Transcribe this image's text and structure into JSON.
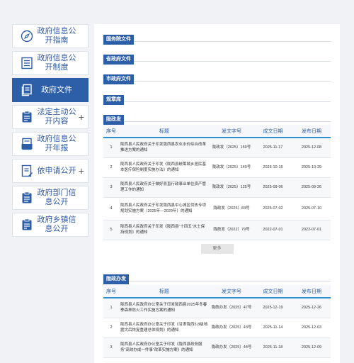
{
  "sidebar": {
    "items": [
      {
        "label": "政府信息公开指南",
        "icon": "compass-icon",
        "expandable": false,
        "active": false
      },
      {
        "label": "政府信息公开制度",
        "icon": "list-document-icon",
        "expandable": false,
        "active": false
      },
      {
        "label": "政府文件",
        "icon": "file-stack-icon",
        "expandable": false,
        "active": true
      },
      {
        "label": "法定主动公开内容",
        "icon": "clipboard-icon",
        "expandable": true,
        "active": false
      },
      {
        "label": "政府信息公开年报",
        "icon": "report-icon",
        "expandable": false,
        "active": false
      },
      {
        "label": "依申请公开",
        "icon": "application-form-icon",
        "expandable": true,
        "active": false
      },
      {
        "label": "政府部门信息公开",
        "icon": "department-doc-icon",
        "expandable": false,
        "active": false
      },
      {
        "label": "政府乡镇信息公开",
        "icon": "township-doc-icon",
        "expandable": false,
        "active": false
      }
    ],
    "expand_symbol": "+"
  },
  "categories": [
    {
      "label": "国务院文件"
    },
    {
      "label": "省政府文件"
    },
    {
      "label": "市政府文件"
    },
    {
      "label": "规章库"
    }
  ],
  "section1": {
    "tag": "陇政发",
    "headers": [
      "序号",
      "标题",
      "发文字号",
      "成文日期",
      "发布日期"
    ],
    "rows": [
      {
        "no": "1",
        "title": "陇西县人民政府关于印发陇西县农业水价综合改革推进方案的通知",
        "doc": "陇政发（2025）159号",
        "written": "2025-11-17",
        "published": "2025-12-08"
      },
      {
        "no": "2",
        "title": "陇西县人民政府关于印发《陇西县统筹城乡居民基本医疗保险制度实施办法》的通知",
        "doc": "陇政发（2025）140号",
        "written": "2025-10-15",
        "published": "2025-10-29"
      },
      {
        "no": "3",
        "title": "陇西县人民政府关于做好县直行政事业单位资产管理工作的通知",
        "doc": "陇政发（2025）125号",
        "written": "2025-09-06",
        "published": "2025-09-26"
      },
      {
        "no": "4",
        "title": "陇西县人民政府关于印发陇西县中心城区供热专项规划实施方案（2025年—2029年）的通知",
        "doc": "陇政发（2025）83号",
        "written": "2025-07-02",
        "published": "2025-07-10"
      },
      {
        "no": "5",
        "title": "陇西县人民政府关于印发《陇西县“十四五”水土保持规划》的通知",
        "doc": "陇政发（2022）79号",
        "written": "2022-07-01",
        "published": "2022-07-01"
      }
    ],
    "more": "更多"
  },
  "section2": {
    "tag": "陇政办发",
    "headers": [
      "序号",
      "标题",
      "发文字号",
      "成文日期",
      "发布日期"
    ],
    "rows": [
      {
        "no": "1",
        "title": "陇西县人民政府办公室关于印发陇西县2025年冬春季森林防火工作实施方案的通知",
        "doc": "陇政办发（2025）47号",
        "written": "2025-12-19",
        "published": "2025-12-26"
      },
      {
        "no": "2",
        "title": "陇西县人民政府办公室关于印发《甘肃陇西5.8级地震灾后恢复重建总体规划》的通知",
        "doc": "陇政办发（2025）43号",
        "written": "2025-11-14",
        "published": "2025-12-03"
      },
      {
        "no": "3",
        "title": "陇西县人民政府办公室关于印发《陇西县政务服务“高效办成一件事”改革实施方案》的通知",
        "doc": "陇政办发（2025）44号",
        "written": "2025-11-18",
        "published": "2025-12-09"
      }
    ]
  },
  "colors": {
    "accent": "#2d5ea8",
    "header_line": "#2d8fd0",
    "background": "#f1f2f5"
  }
}
